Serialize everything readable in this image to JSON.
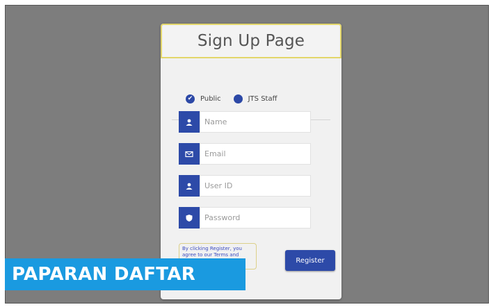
{
  "form": {
    "title": "Sign Up Page",
    "user_type": {
      "options": [
        "Public",
        "JTS Staff"
      ],
      "selected": "Public"
    },
    "fields": [
      {
        "placeholder": "Name",
        "icon": "user-icon"
      },
      {
        "placeholder": "Email",
        "icon": "email-icon"
      },
      {
        "placeholder": "User ID",
        "icon": "user-icon"
      },
      {
        "placeholder": "Password",
        "icon": "shield-icon"
      }
    ],
    "terms_text": "By clicking Register, you agree to our Terms and",
    "register_label": "Register"
  },
  "caption": {
    "text": "PAPARAN DAFTAR"
  },
  "colors": {
    "accent": "#2d4aa8",
    "background": "#7d7d7d",
    "caption_bg": "#1a9ae0"
  }
}
